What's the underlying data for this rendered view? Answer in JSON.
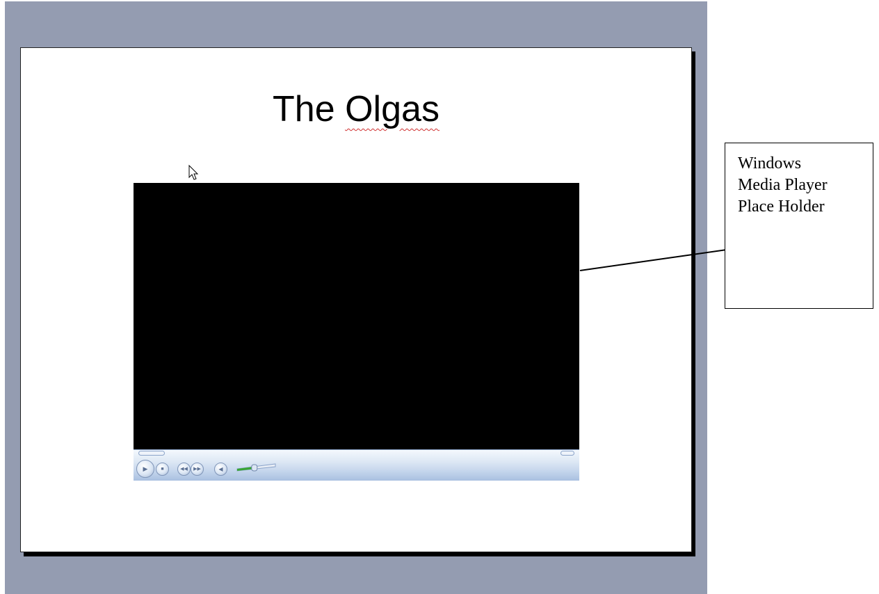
{
  "slide": {
    "title_prefix": "The ",
    "title_misspelled": "Olgas"
  },
  "media_player": {
    "play_icon": "play-icon",
    "stop_icon": "stop-icon",
    "prev_icon": "previous-icon",
    "next_icon": "next-icon",
    "mute_icon": "volume-icon",
    "volume_level": 0.45
  },
  "callout": {
    "text": "Windows\nMedia Player\nPlace Holder"
  },
  "colors": {
    "canvas_background": "#949cb1",
    "video_background": "#000000",
    "volume_fill": "#3aa635",
    "spell_check": "#d03030"
  }
}
